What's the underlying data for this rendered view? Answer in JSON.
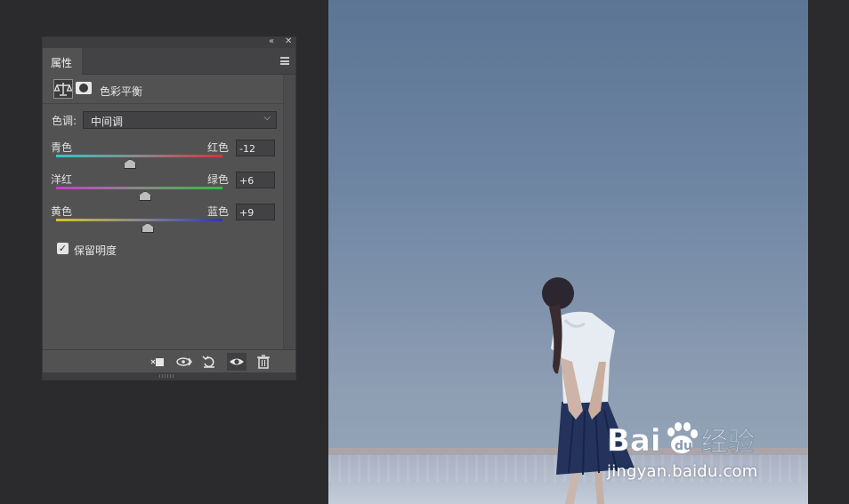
{
  "panel": {
    "tab_label": "属性",
    "adjustment_title": "色彩平衡",
    "tone": {
      "label": "色调:",
      "selected": "中间调"
    },
    "sliders": [
      {
        "left": "青色",
        "right": "红色",
        "value": "-12",
        "level": -12,
        "gradient": [
          "#31c7c7",
          "#d9313a"
        ]
      },
      {
        "left": "洋红",
        "right": "绿色",
        "value": "+6",
        "level": 6,
        "gradient": [
          "#c93bc9",
          "#2fbf3a"
        ]
      },
      {
        "left": "黄色",
        "right": "蓝色",
        "value": "+9",
        "level": 9,
        "gradient": [
          "#d6c42a",
          "#2a35c0"
        ]
      }
    ],
    "preserve_luminosity": {
      "label": "保留明度",
      "checked": true
    },
    "footer_icons": [
      "clip-to-layer-icon",
      "view-previous-icon",
      "reset-icon",
      "visibility-eye-icon",
      "trash-icon"
    ]
  },
  "watermark": {
    "logo_text": "Bai  经验",
    "url": "jingyan.baidu.com"
  }
}
